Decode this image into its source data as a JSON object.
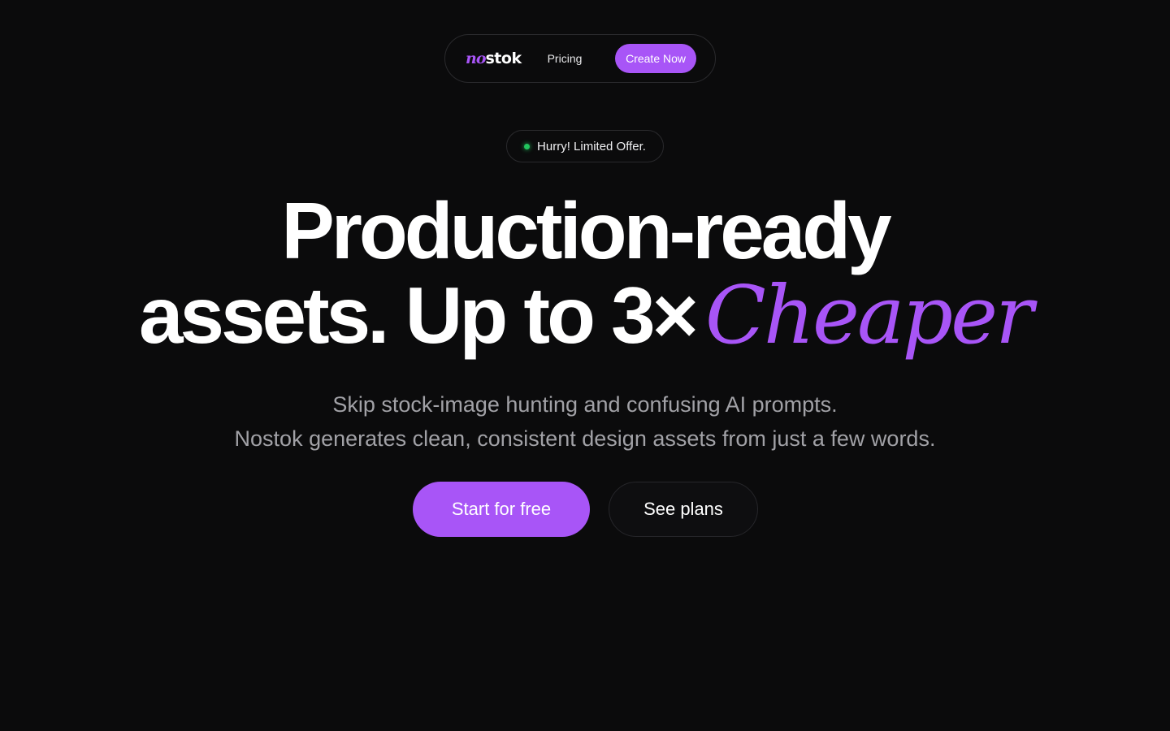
{
  "nav": {
    "logo_mark": "no",
    "logo_text": "stok",
    "pricing_label": "Pricing",
    "cta_label": "Create Now"
  },
  "badge": {
    "text": "Hurry! Limited Offer."
  },
  "hero": {
    "line1": "Production-ready",
    "line2": "assets. Up to 3×",
    "accent": "Cheaper",
    "subtitle_line1": "Skip stock-image hunting and confusing AI prompts.",
    "subtitle_line2": "Nostok generates clean, consistent design assets from just a few words."
  },
  "actions": {
    "primary_label": "Start for free",
    "secondary_label": "See plans"
  },
  "colors": {
    "background": "#0b0b0c",
    "accent": "#a855f7",
    "status_dot": "#22c55e",
    "muted_text": "#a1a1a6"
  }
}
